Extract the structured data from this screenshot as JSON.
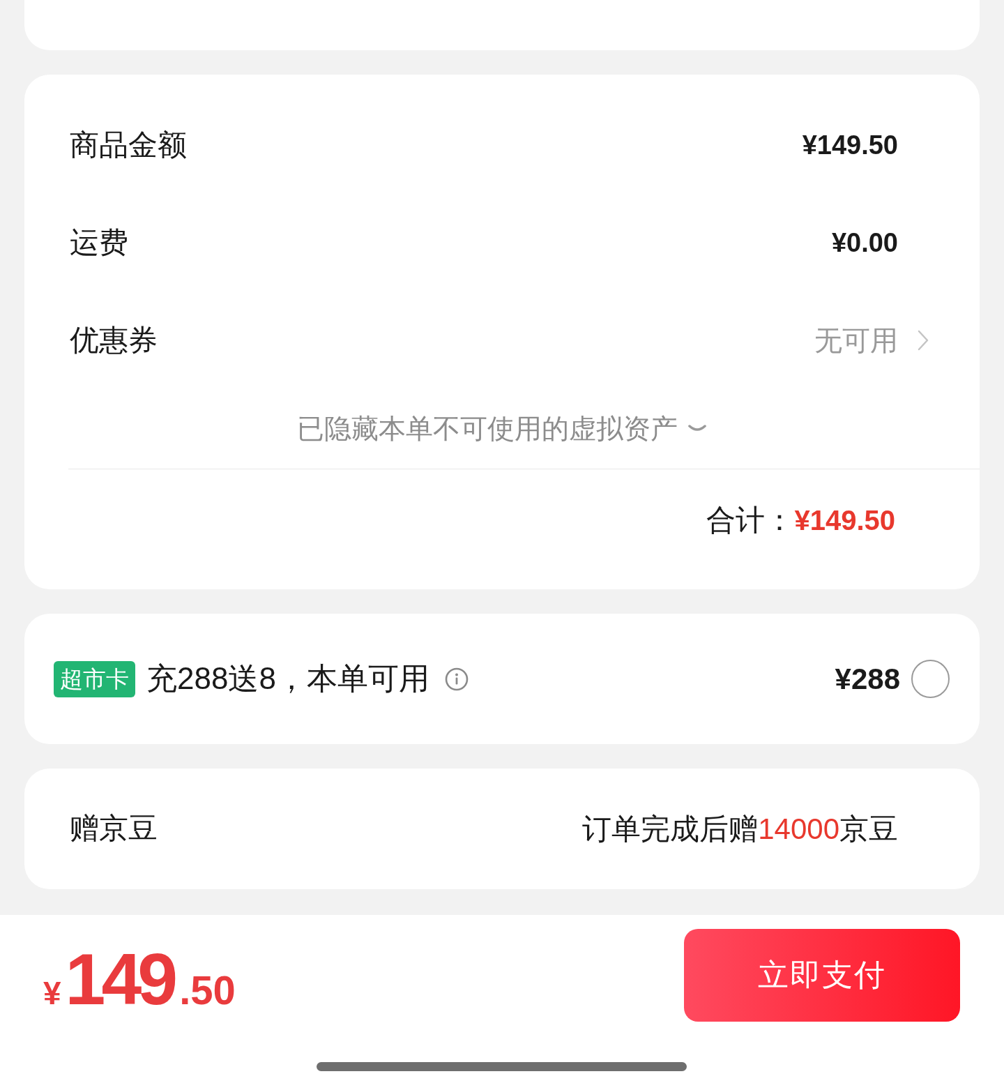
{
  "summary": {
    "rows": [
      {
        "kind": "amount",
        "label": "商品金额",
        "value": "¥149.50"
      },
      {
        "kind": "amount",
        "label": "运费",
        "value": "¥0.00"
      },
      {
        "kind": "link",
        "label": "优惠券",
        "value": "无可用"
      }
    ],
    "hidden_note": {
      "text": "已隐藏本单不可使用的虚拟资产",
      "expanded": false
    },
    "total": {
      "label": "合计：",
      "value": "¥149.50"
    }
  },
  "card_offer": {
    "badge": "超市卡",
    "text": "充288送8，本单可用",
    "price": "¥288",
    "selected": false
  },
  "beans": {
    "label": "赠京豆",
    "text": "订单完成后赠**14000**京豆"
  },
  "footer": {
    "price": {
      "currency": "¥",
      "integer": "149",
      "decimal": ".50"
    },
    "pay_button": "立即支付"
  }
}
